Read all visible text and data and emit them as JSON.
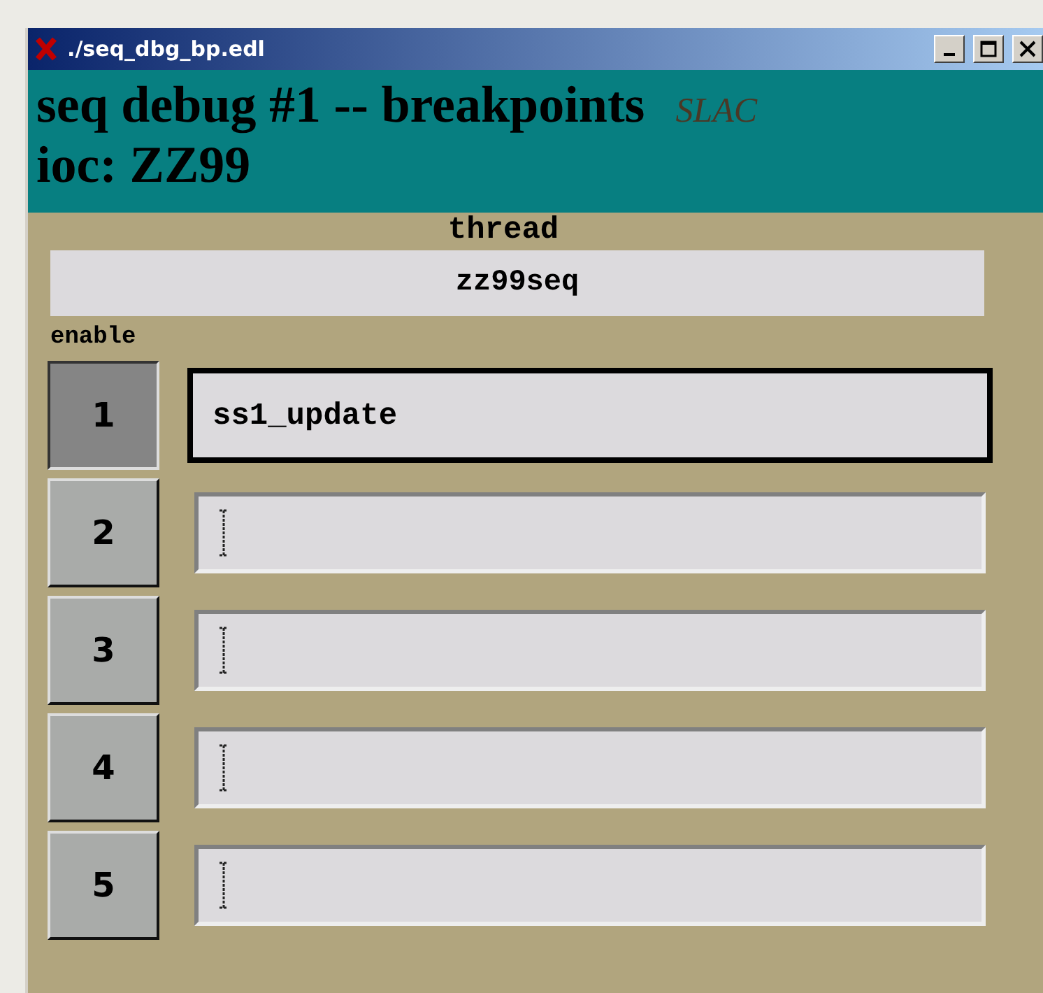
{
  "window": {
    "title": "./seq_dbg_bp.edl"
  },
  "header": {
    "title": "seq debug #1 -- breakpoints",
    "logo": "SLAC",
    "ioc": "ioc: ZZ99"
  },
  "thread": {
    "label": "thread",
    "value": "zz99seq"
  },
  "enable_label": "enable",
  "breakpoints": [
    {
      "label": "1",
      "on": true,
      "value": "ss1_update",
      "focused": true
    },
    {
      "label": "2",
      "on": false,
      "focused": false
    },
    {
      "label": "3",
      "on": false,
      "focused": false
    },
    {
      "label": "4",
      "on": false,
      "focused": false
    },
    {
      "label": "5",
      "on": false,
      "focused": false
    }
  ]
}
